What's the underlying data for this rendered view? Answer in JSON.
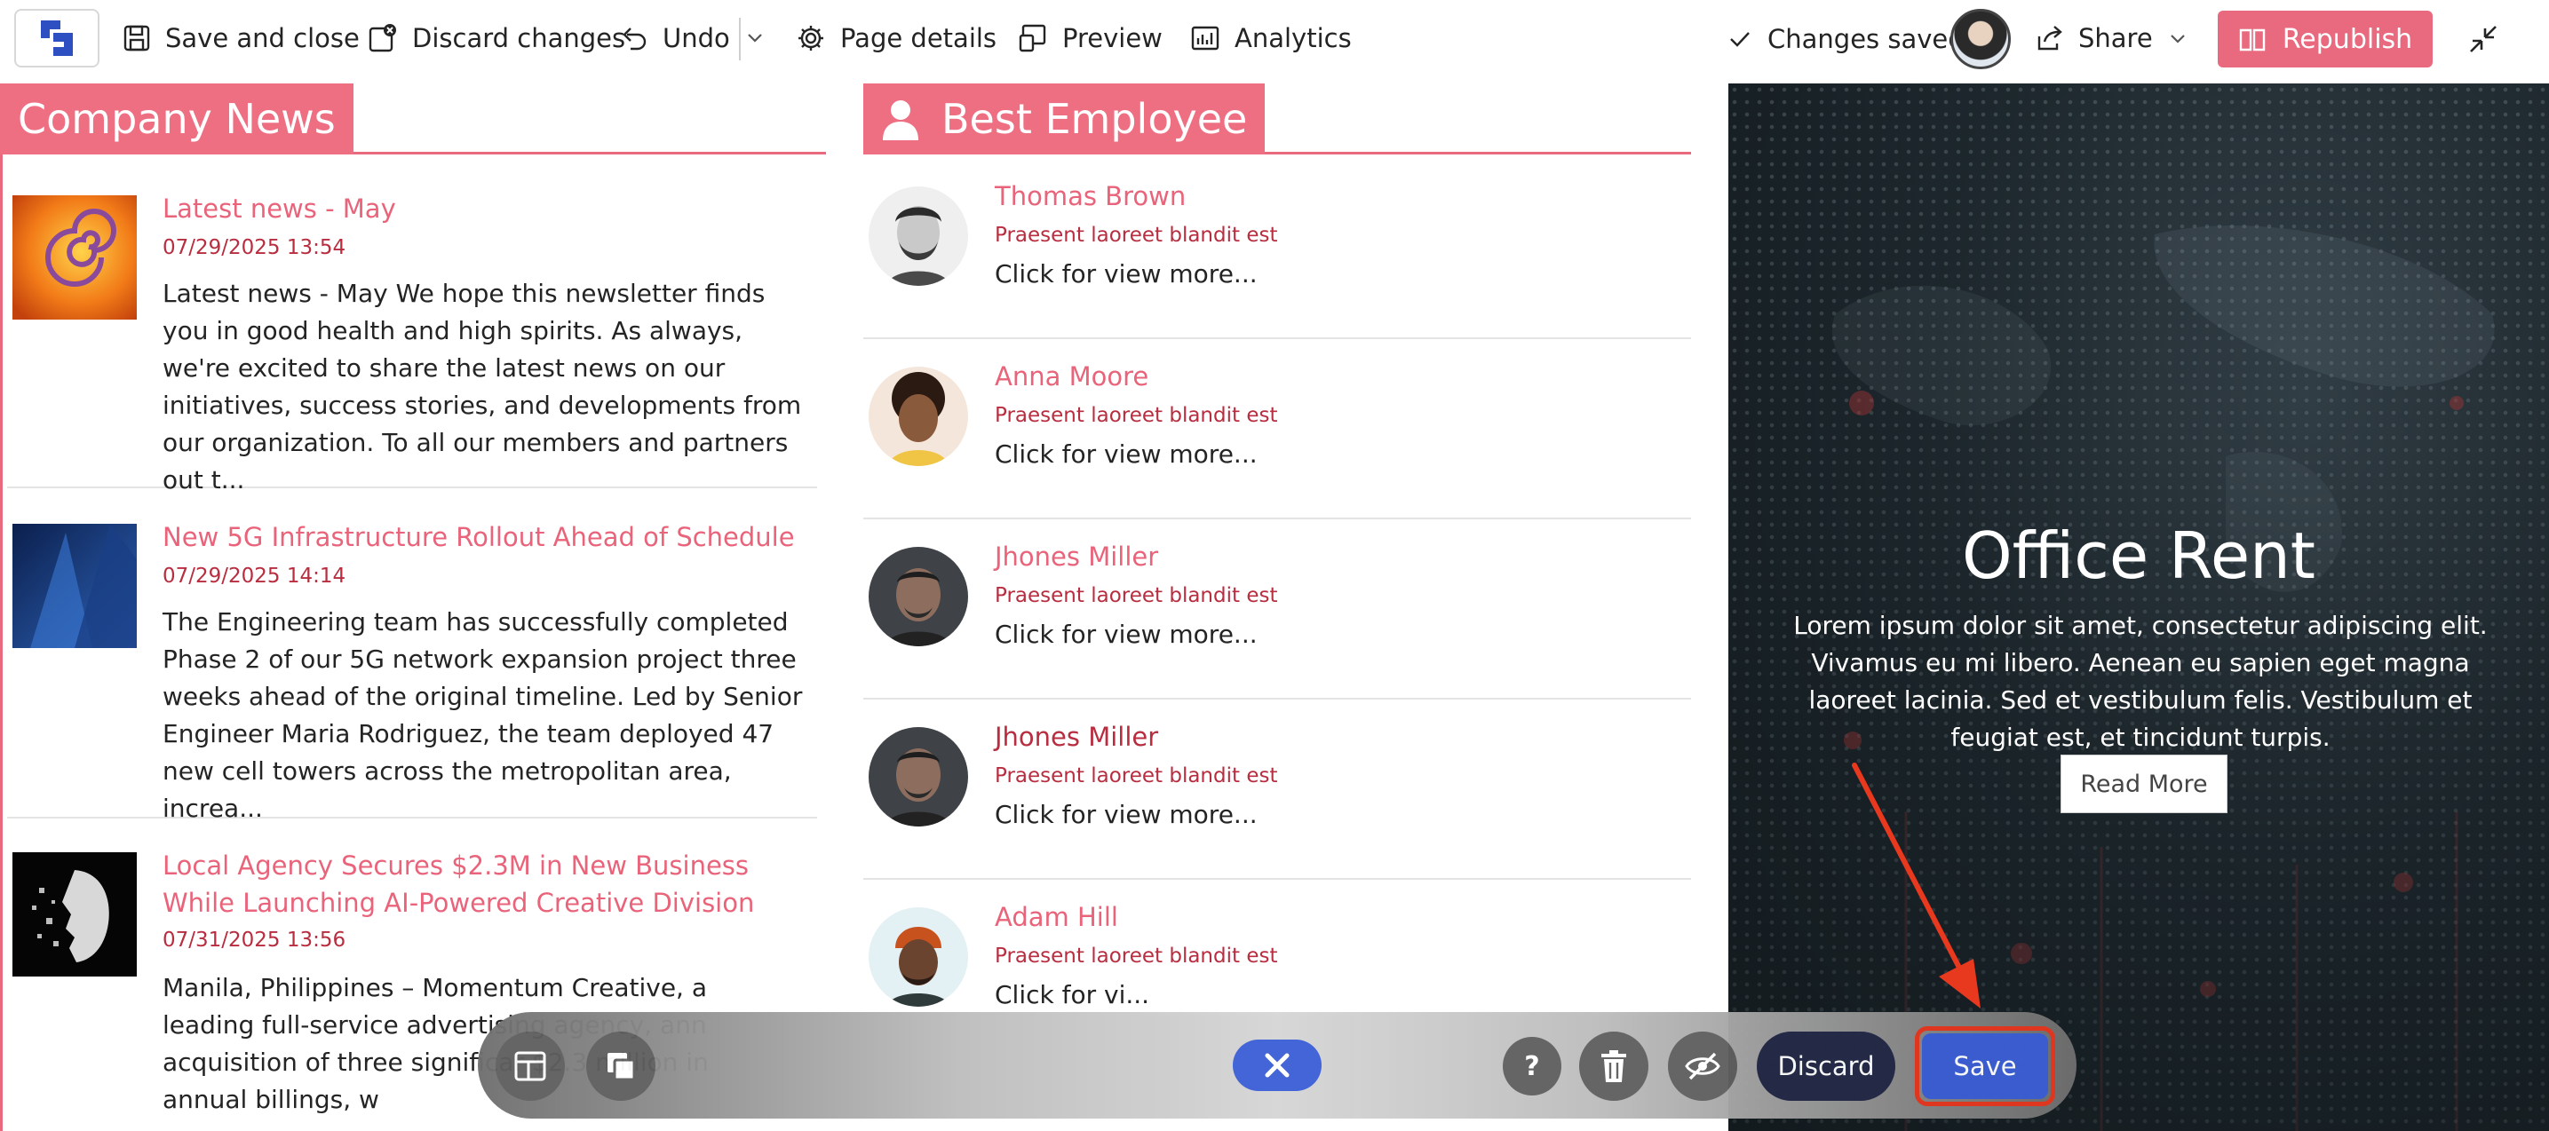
{
  "toolbar": {
    "save_close": "Save and close",
    "discard_changes": "Discard changes",
    "undo": "Undo",
    "page_details": "Page details",
    "preview": "Preview",
    "analytics": "Analytics",
    "status": "Changes saved",
    "share": "Share",
    "republish": "Republish"
  },
  "news": {
    "heading": "Company News",
    "items": [
      {
        "title": "Latest news - May",
        "date": "07/29/2025 13:54",
        "body": "Latest news - May We hope this newsletter finds you in good health and high spirits. As always, we're excited to share the latest news on our initiatives, success stories, and developments from our organization. To all our members and partners out t..."
      },
      {
        "title": "New 5G Infrastructure Rollout Ahead of Schedule",
        "date": "07/29/2025 14:14",
        "body": "The Engineering team has successfully completed Phase 2 of our 5G network expansion project three weeks ahead of the original timeline. Led by Senior Engineer Maria Rodriguez, the team deployed 47 new cell towers across the metropolitan area, increa..."
      },
      {
        "title": "Local Agency Secures $2.3M in New Business While Launching AI-Powered Creative Division",
        "date": "07/31/2025 13:56",
        "body": "Manila, Philippines – Momentum Creative, a leading full-service advertising agency, ann acquisition of three significar $2.3 million in annual billings, w"
      }
    ]
  },
  "employees": {
    "heading": "Best Employee",
    "items": [
      {
        "name": "Thomas Brown",
        "subtitle": "Praesent laoreet blandit est",
        "more": "Click for view more..."
      },
      {
        "name": "Anna Moore",
        "subtitle": "Praesent laoreet blandit est",
        "more": "Click for view more..."
      },
      {
        "name": "Jhones Miller",
        "subtitle": "Praesent laoreet blandit est",
        "more": "Click for view more..."
      },
      {
        "name": "Jhones Miller",
        "subtitle": "Praesent laoreet blandit est",
        "more": "Click for view more..."
      },
      {
        "name": "Adam Hill",
        "subtitle": "Praesent laoreet blandit est",
        "more": "Click for vi..."
      }
    ]
  },
  "hero": {
    "title": "Office Rent",
    "text": "Lorem ipsum dolor sit amet, consectetur adipiscing elit. Vivamus eu mi libero. Aenean eu sapien eget magna laoreet lacinia. Sed et vestibulum felis. Vestibulum et feugiat est, et tincidunt turpis.",
    "button": "Read More"
  },
  "floatbar": {
    "discard": "Discard",
    "save": "Save",
    "help": "?"
  },
  "colors": {
    "accent": "#e96a7e",
    "date": "#b82d3f",
    "primary_blue": "#3c5fd6",
    "callout_red": "#e8391f"
  }
}
